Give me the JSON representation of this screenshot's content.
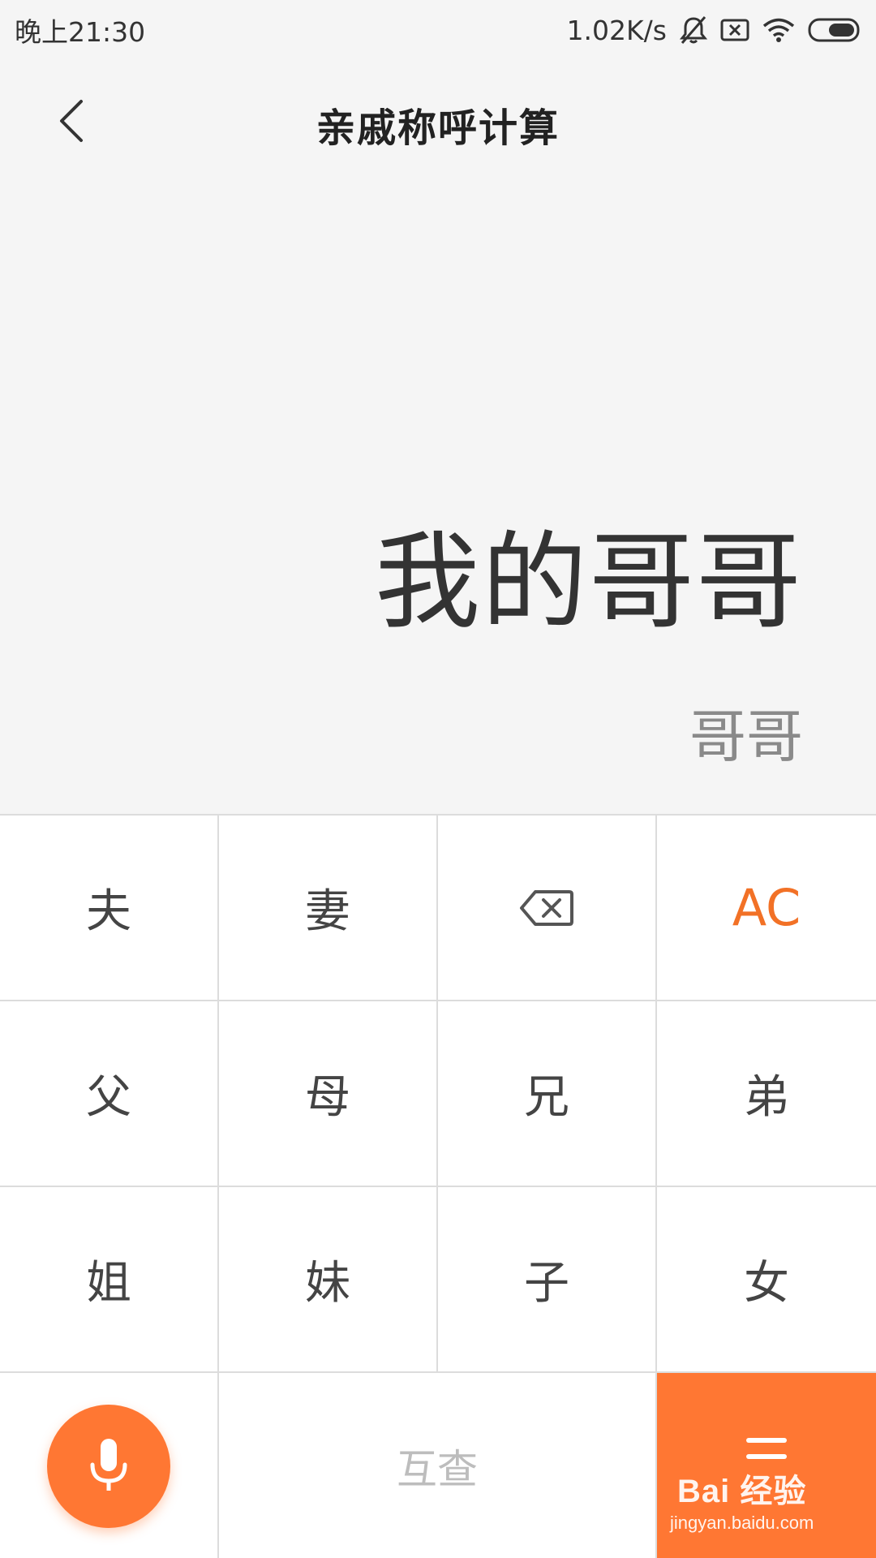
{
  "status_bar": {
    "time": "晚上21:30",
    "net_speed": "1.02K/s",
    "icons": [
      "mute-bell-icon",
      "sim-off-icon",
      "wifi-icon",
      "battery-icon"
    ]
  },
  "header": {
    "title": "亲戚称呼计算",
    "back_icon": "chevron-left-icon"
  },
  "display": {
    "expression": "我的哥哥",
    "result": "哥哥"
  },
  "keypad": {
    "row1": [
      "夫",
      "妻",
      "backspace-icon",
      "AC"
    ],
    "row2": [
      "父",
      "母",
      "兄",
      "弟"
    ],
    "row3": [
      "姐",
      "妹",
      "子",
      "女"
    ],
    "row4": {
      "mic_icon": "microphone-icon",
      "lookup_label": "互查",
      "equal_icon": "equals-icon"
    },
    "accent_color": "#ff7733",
    "ac_color": "#f27126"
  },
  "watermark": {
    "logo": "Bai 经验",
    "url": "jingyan.baidu.com"
  }
}
